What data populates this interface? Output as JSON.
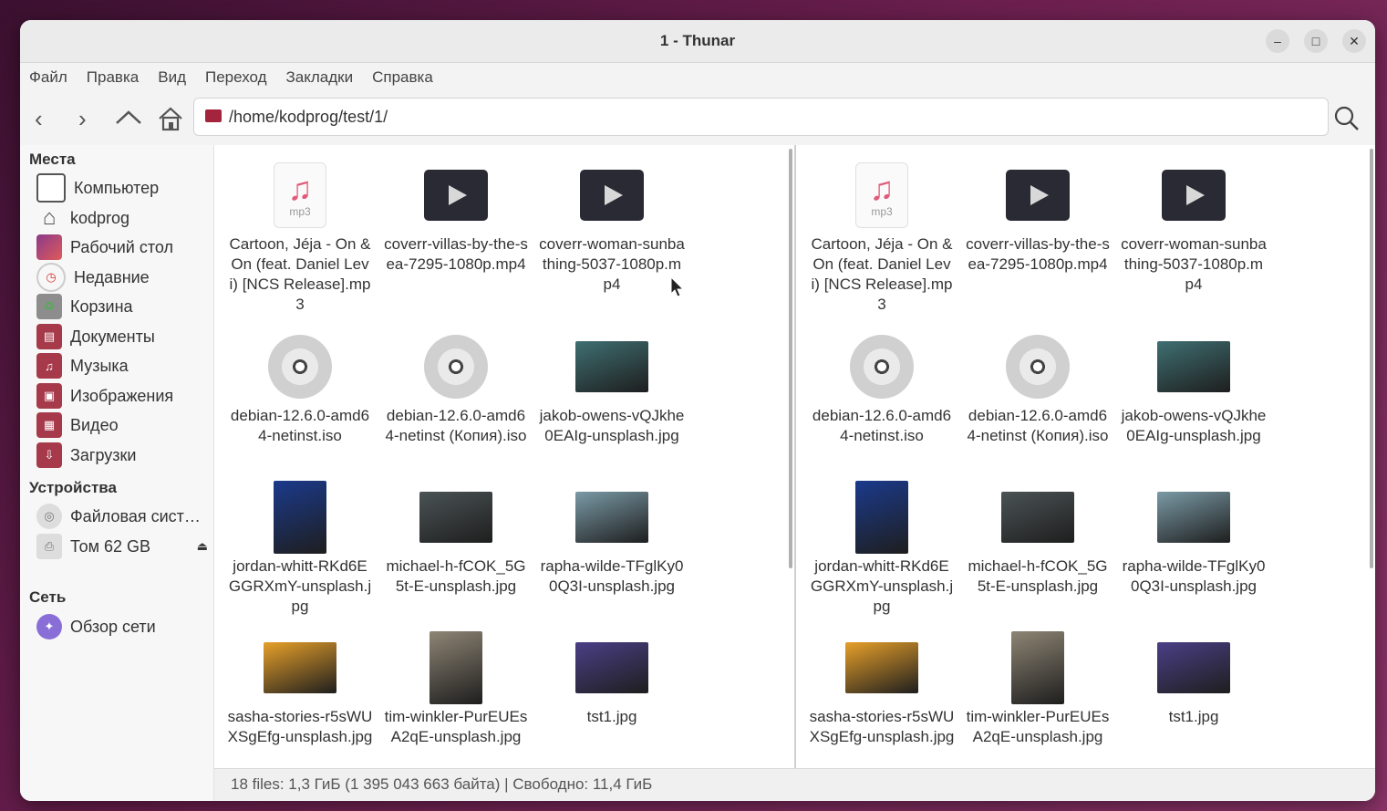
{
  "window": {
    "title": "1 - Thunar"
  },
  "menu": [
    "Файл",
    "Правка",
    "Вид",
    "Переход",
    "Закладки",
    "Справка"
  ],
  "location": {
    "path": "/home/kodprog/test/1/"
  },
  "sidebar": {
    "places_header": "Места",
    "places": [
      {
        "label": "Компьютер",
        "icon": "computer-icon"
      },
      {
        "label": "kodprog",
        "icon": "home-icon"
      },
      {
        "label": "Рабочий стол",
        "icon": "desktop-icon"
      },
      {
        "label": "Недавние",
        "icon": "clock-icon"
      },
      {
        "label": "Корзина",
        "icon": "trash-icon"
      },
      {
        "label": "Документы",
        "icon": "documents-folder-icon"
      },
      {
        "label": "Музыка",
        "icon": "music-folder-icon"
      },
      {
        "label": "Изображения",
        "icon": "pictures-folder-icon"
      },
      {
        "label": "Видео",
        "icon": "videos-folder-icon"
      },
      {
        "label": "Загрузки",
        "icon": "downloads-folder-icon"
      }
    ],
    "devices_header": "Устройства",
    "devices": [
      {
        "label": "Файловая сист…",
        "icon": "drive-icon"
      },
      {
        "label": "Том 62 GB",
        "icon": "usb-drive-icon"
      }
    ],
    "network_header": "Сеть",
    "network": [
      {
        "label": "Обзор сети",
        "icon": "network-icon"
      }
    ]
  },
  "files": [
    {
      "name": "Cartoon, Jéja - On & On (feat. Daniel Levi) [NCS Release].mp3",
      "type": "mp3"
    },
    {
      "name": "coverr-villas-by-the-sea-7295-1080p.mp4",
      "type": "video"
    },
    {
      "name": "coverr-woman-sunbathing-5037-1080p.mp4",
      "type": "video"
    },
    {
      "name": "debian-12.6.0-amd64-netinst.iso",
      "type": "iso"
    },
    {
      "name": "debian-12.6.0-amd64-netinst (Копия).iso",
      "type": "iso"
    },
    {
      "name": "jakob-owens-vQJkhe0EAIg-unsplash.jpg",
      "type": "image",
      "color": "#3f6f72"
    },
    {
      "name": "jordan-whitt-RKd6EGGRXmY-unsplash.jpg",
      "type": "image-tall",
      "color": "#1b3a8c"
    },
    {
      "name": "michael-h-fCOK_5G5t-E-unsplash.jpg",
      "type": "image",
      "color": "#4b5355"
    },
    {
      "name": "rapha-wilde-TFglKy00Q3I-unsplash.jpg",
      "type": "image",
      "color": "#7a9aa6"
    },
    {
      "name": "sasha-stories-r5sWUXSgEfg-unsplash.jpg",
      "type": "image",
      "color": "#e7a02a"
    },
    {
      "name": "tim-winkler-PurEUEsA2qE-unsplash.jpg",
      "type": "image-tall",
      "color": "#8e8574"
    },
    {
      "name": "tst1.jpg",
      "type": "image",
      "color": "#4b3f86"
    }
  ],
  "statusbar": {
    "text": "18 files: 1,3 ГиБ (1 395 043 663 байта)  |  Свободно: 11,4 ГиБ"
  }
}
